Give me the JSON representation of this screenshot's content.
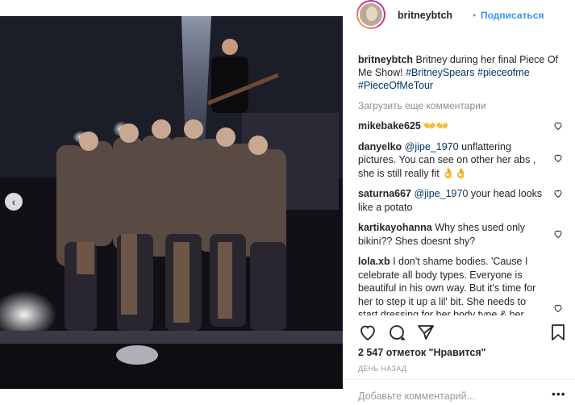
{
  "post": {
    "username": "britneybtch",
    "follow_label": "Подписаться",
    "separator": "•",
    "caption_user": "britneybtch",
    "caption_text": "Britney during her final Piece Of Me Show! ",
    "caption_tags": [
      "#BritneySpears",
      "#pieceofme",
      "#PieceOfMeTour"
    ],
    "load_more": "Загрузить еще комментарии",
    "likes": "2 547 отметок \"Нравится\"",
    "time_ago": "ДЕНЬ НАЗАД",
    "add_comment_placeholder": "Добавьте комментарий...",
    "more_label": "•••"
  },
  "comments": [
    {
      "user": "mikebake625",
      "text": "👐👐"
    },
    {
      "user": "danyelko",
      "mention": "@jipe_1970",
      "text": " unflattering pictures. You can see on other her abs , she is still really fit 👌👌"
    },
    {
      "user": "saturna667",
      "mention": "@jipe_1970",
      "text": " your head looks like a potato"
    },
    {
      "user": "kartikayohanna",
      "text": "Why shes used only bikini?? Shes doesnt shy?"
    },
    {
      "user": "lola.xb",
      "text": "I don't shame bodies. 'Cause I celebrate all body types. Everyone is beautiful in his own way. But it's time for her to step it up a lil' bit. She needs to start dressing for her body type & her age. Hire a new glam squad. She is"
    }
  ],
  "colors": {
    "link": "#3897f0",
    "tag": "#003569",
    "muted": "#8e8e8e"
  },
  "icons": [
    "heart-icon",
    "comment-icon",
    "share-icon",
    "bookmark-icon",
    "chevron-left-icon"
  ]
}
